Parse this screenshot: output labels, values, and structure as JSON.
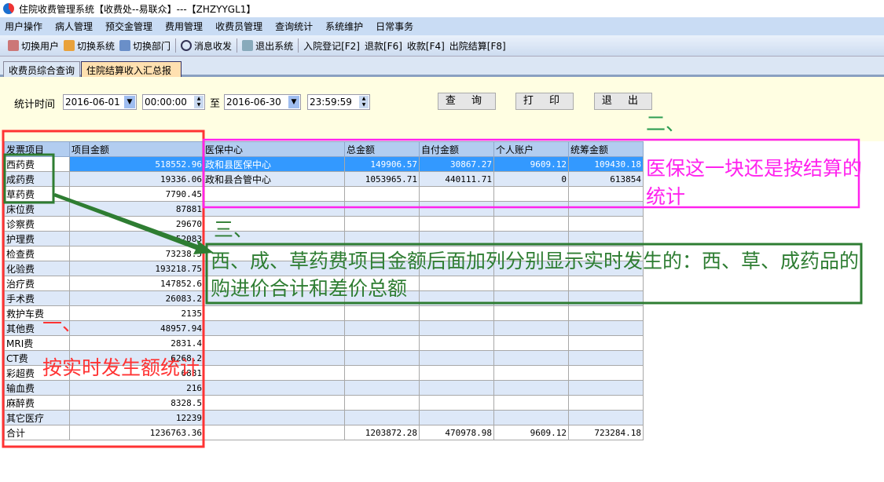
{
  "window": {
    "title": "住院收费管理系统【收费处--易联众】---【ZHZYYGL1】"
  },
  "menu": [
    "用户操作",
    "病人管理",
    "预交金管理",
    "费用管理",
    "收费员管理",
    "查询统计",
    "系统维护",
    "日常事务"
  ],
  "toolbar": {
    "switch_user": "切换用户",
    "switch_system": "切换系统",
    "switch_dept": "切换部门",
    "messages": "消息收发",
    "exit_system": "退出系统",
    "admit": "入院登记[F2]",
    "refund": "退款[F6]",
    "charge": "收款[F4]",
    "discharge": "出院结算[F8]"
  },
  "tabs": [
    "收费员综合查询",
    "住院结算收入汇总报表"
  ],
  "filter": {
    "label": "统计时间",
    "start_date": "2016-06-01",
    "start_time": "00:00:00",
    "to": "至",
    "end_date": "2016-06-30",
    "end_time": "23:59:59",
    "query": "查 询",
    "print": "打 印",
    "exit": "退 出"
  },
  "left_grid": {
    "headers": [
      "发票项目",
      "项目金额"
    ],
    "rows": [
      [
        "西药费",
        "518552.96"
      ],
      [
        "成药费",
        "19336.06"
      ],
      [
        "草药费",
        "7790.45"
      ],
      [
        "床位费",
        "87881"
      ],
      [
        "诊察费",
        "29670"
      ],
      [
        "护理费",
        "52083"
      ],
      [
        "检查费",
        "73238.5"
      ],
      [
        "化验费",
        "193218.75"
      ],
      [
        "治疗费",
        "147852.6"
      ],
      [
        "手术费",
        "26083.2"
      ],
      [
        "救护车费",
        "2135"
      ],
      [
        "其他费",
        "48957.94"
      ],
      [
        "MRI费",
        "2831.4"
      ],
      [
        "CT费",
        "6268.2"
      ],
      [
        "彩超费",
        "6881"
      ],
      [
        "输血费",
        "216"
      ],
      [
        "麻醉费",
        "8328.5"
      ],
      [
        "其它医疗",
        "12239"
      ],
      [
        "合计",
        "1236763.36"
      ]
    ]
  },
  "right_grid": {
    "headers": [
      "医保中心",
      "总金额",
      "自付金额",
      "个人账户",
      "统筹金额"
    ],
    "rows": [
      [
        "政和县医保中心",
        "149906.57",
        "30867.27",
        "9609.12",
        "109430.18"
      ],
      [
        "政和县合管中心",
        "1053965.71",
        "440111.71",
        "0",
        "613854"
      ]
    ],
    "total": [
      "",
      "1203872.28",
      "470978.98",
      "9609.12",
      "723284.18"
    ]
  },
  "annotations": {
    "one": "一、",
    "one_text": "按实时发生额统计",
    "two": "二、",
    "two_text": "医保这一块还是按结算的统计",
    "three": "三、",
    "three_text": "西、成、草药费项目金额后面加列分别显示实时发生的：西、草、成药品的购进价合计和差价总额"
  },
  "colors": {
    "selection": "#3399ff",
    "annot_red": "#ff3333",
    "annot_green": "#2e7d32",
    "annot_magenta": "#ff22ee"
  }
}
